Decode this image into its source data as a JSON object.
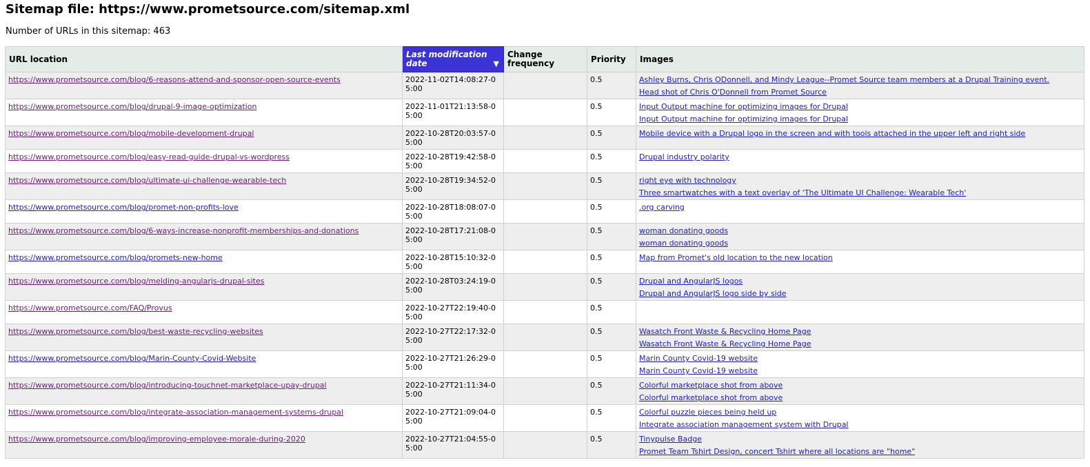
{
  "page": {
    "title": "Sitemap file: https://www.prometsource.com/sitemap.xml",
    "url_count_label": "Number of URLs in this sitemap: 463"
  },
  "table": {
    "headers": {
      "url": "URL location",
      "lastmod": "Last modification date",
      "changefreq": "Change frequency",
      "priority": "Priority",
      "images": "Images"
    },
    "sort_indicator": "▼",
    "rows": [
      {
        "url": "https://www.prometsource.com/blog/6-reasons-attend-and-sponsor-open-source-events",
        "lastmod": "2022-11-02T14:08:27-05:00",
        "changefreq": "",
        "priority": "0.5",
        "images": [
          "Ashley Burns, Chris ODonnell, and Mindy League--Promet Source team members at a Drupal Training event.",
          "Head shot of Chris O'Donnell from Promet Source"
        ]
      },
      {
        "url": "https://www.prometsource.com/blog/drupal-9-image-optimization",
        "lastmod": "2022-11-01T21:13:58-05:00",
        "changefreq": "",
        "priority": "0.5",
        "images": [
          "Input Output machine for optimizing images for Drupal",
          "Input Output machine for optimizing images for Drupal"
        ]
      },
      {
        "url": "https://www.prometsource.com/blog/mobile-development-drupal",
        "lastmod": "2022-10-28T20:03:57-05:00",
        "changefreq": "",
        "priority": "0.5",
        "images": [
          "Mobile device with a Drupal logo in the screen and with tools attached in the upper left and right side"
        ]
      },
      {
        "url": "https://www.prometsource.com/blog/easy-read-guide-drupal-vs-wordpress",
        "lastmod": "2022-10-28T19:42:58-05:00",
        "changefreq": "",
        "priority": "0.5",
        "images": [
          "Drupal industry polarity"
        ]
      },
      {
        "url": "https://www.prometsource.com/blog/ultimate-ui-challenge-wearable-tech",
        "lastmod": "2022-10-28T19:34:52-05:00",
        "changefreq": "",
        "priority": "0.5",
        "images": [
          "right eye with technology",
          "Three smartwatches with a text overlay of 'The Ultimate UI Challenge: Wearable Tech'"
        ]
      },
      {
        "url": "https://www.prometsource.com/blog/promet-non-profits-love",
        "lastmod": "2022-10-28T18:08:07-05:00",
        "changefreq": "",
        "priority": "0.5",
        "images": [
          ".org carving"
        ]
      },
      {
        "url": "https://www.prometsource.com/blog/6-ways-increase-nonprofit-memberships-and-donations",
        "lastmod": "2022-10-28T17:21:08-05:00",
        "changefreq": "",
        "priority": "0.5",
        "images": [
          "woman donating goods",
          "woman donating goods"
        ]
      },
      {
        "url": "https://www.prometsource.com/blog/promets-new-home",
        "lastmod": "2022-10-28T15:10:32-05:00",
        "changefreq": "",
        "priority": "0.5",
        "images": [
          "Map from Promet's old location to the new location"
        ]
      },
      {
        "url": "https://www.prometsource.com/blog/melding-angularjs-drupal-sites",
        "lastmod": "2022-10-28T03:24:19-05:00",
        "changefreq": "",
        "priority": "0.5",
        "images": [
          "Drupal and AngularJS logos",
          "Drupal and AngularJS logo side by side"
        ]
      },
      {
        "url": "https://www.prometsource.com/FAQ/Provus",
        "lastmod": "2022-10-27T22:19:40-05:00",
        "changefreq": "",
        "priority": "0.5",
        "images": []
      },
      {
        "url": "https://www.prometsource.com/blog/best-waste-recycling-websites",
        "lastmod": "2022-10-27T22:17:32-05:00",
        "changefreq": "",
        "priority": "0.5",
        "images": [
          "Wasatch Front Waste & Recycling Home Page",
          "Wasatch Front Waste & Recycling Home Page"
        ]
      },
      {
        "url": "https://www.prometsource.com/blog/Marin-County-Covid-Website",
        "lastmod": "2022-10-27T21:26:29-05:00",
        "changefreq": "",
        "priority": "0.5",
        "images": [
          "Marin County Covid-19 website",
          "Marin County Covid-19 website"
        ]
      },
      {
        "url": "https://www.prometsource.com/blog/introducing-touchnet-marketplace-upay-drupal",
        "lastmod": "2022-10-27T21:11:34-05:00",
        "changefreq": "",
        "priority": "0.5",
        "images": [
          "Colorful marketplace shot from above",
          "Colorful marketplace shot from above"
        ]
      },
      {
        "url": "https://www.prometsource.com/blog/integrate-association-management-systems-drupal",
        "lastmod": "2022-10-27T21:09:04-05:00",
        "changefreq": "",
        "priority": "0.5",
        "images": [
          "Colorful puzzle pieces being held up",
          "Integrate association management system with Drupal"
        ]
      },
      {
        "url": "https://www.prometsource.com/blog/improving-employee-morale-during-2020",
        "lastmod": "2022-10-27T21:04:55-05:00",
        "changefreq": "",
        "priority": "0.5",
        "images": [
          "Tinypulse Badge",
          "Promet Team Tshirt Design, concert Tshirt where all locations are \"home\""
        ]
      }
    ]
  }
}
